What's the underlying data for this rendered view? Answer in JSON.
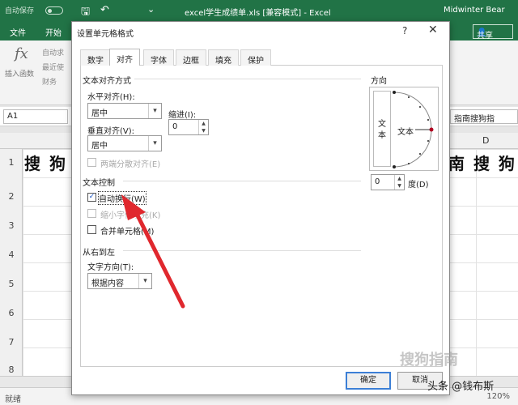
{
  "excel": {
    "autosave_label": "自动保存",
    "title": "excel学生成绩单.xls  [兼容模式]  -  Excel",
    "user": "Midwinter Bear",
    "tabs": [
      "文件",
      "开始"
    ],
    "share_label": "共享",
    "fx_label": "插入函数",
    "ribbon_items": [
      "自动求",
      "最近使",
      "财务"
    ],
    "name_box": "A1",
    "formula_right": "指南搜狗指",
    "column_d": "D",
    "rows": [
      "1",
      "2",
      "3",
      "4",
      "5",
      "6",
      "7",
      "8"
    ],
    "cell_left": "搜 狗 ",
    "cell_right": "南 搜 狗",
    "status_ready": "就绪",
    "zoom": "120%"
  },
  "dialog": {
    "title": "设置单元格格式",
    "help": "?",
    "close": "✕",
    "tabs": [
      "数字",
      "对齐",
      "字体",
      "边框",
      "填充",
      "保护"
    ],
    "active_tab": "对齐",
    "text_alignment_section": "文本对齐方式",
    "horizontal_label": "水平对齐(H):",
    "horizontal_value": "居中",
    "indent_label": "缩进(I):",
    "indent_value": "0",
    "vertical_label": "垂直对齐(V):",
    "vertical_value": "居中",
    "justify_distributed": "两端分散对齐(E)",
    "text_control_section": "文本控制",
    "wrap_text": "自动换行(W)",
    "wrap_text_checked": true,
    "shrink_to_fit": "缩小字体填充(K)",
    "merge_cells": "合并单元格(M)",
    "rtl_section": "从右到左",
    "text_direction_label": "文字方向(T):",
    "text_direction_value": "根据内容",
    "orientation_section": "方向",
    "orientation_vertical_text": "文本",
    "orientation_text": "文本",
    "degrees_value": "0",
    "degrees_label": "度(D)",
    "ok": "确定",
    "cancel": "取消"
  },
  "watermark": {
    "brand": "头条 @钱布斯",
    "site": "搜狗指南"
  },
  "colors": {
    "excel_green": "#217346",
    "arrow_red": "#e0282e",
    "focus_blue": "#3c7fd6"
  }
}
